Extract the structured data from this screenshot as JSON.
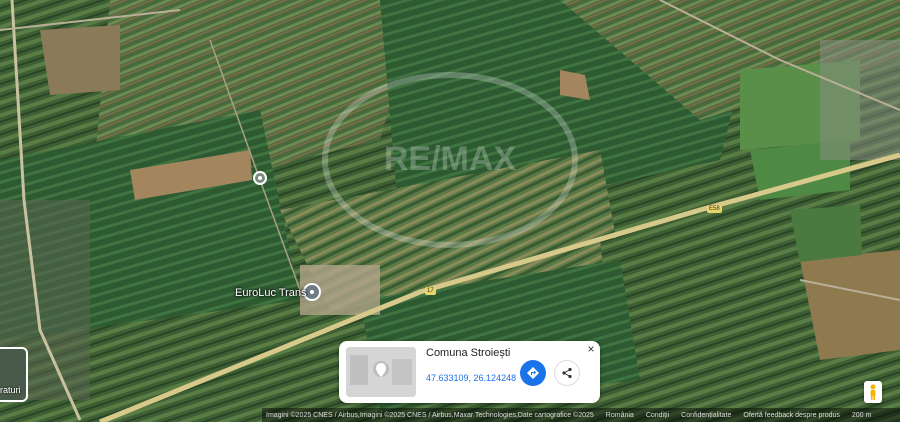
{
  "map": {
    "road_shields": [
      "E58",
      "17"
    ],
    "places": [
      {
        "name": "EuroLuc Trans"
      }
    ],
    "watermark": "RE/MAX"
  },
  "info_card": {
    "title": "Comuna Stroiești",
    "coordinates": "47.633109, 26.124248",
    "directions_icon": "directions-icon",
    "share_icon": "share-icon",
    "close_label": "×"
  },
  "layers_control": {
    "label_fragment": "raturi"
  },
  "pegman": {
    "icon": "pegman-icon"
  },
  "bottom_bar": {
    "imagery_credit": "Imagini ©2025 CNES / Airbus,Imagini ©2025 CNES / Airbus,Maxar Technologies,Date cartografice ©2025",
    "links": [
      "România",
      "Condiții",
      "Confidențialitate",
      "Ofertă feedback despre produs"
    ],
    "scale": "200 m"
  },
  "colors": {
    "accent": "#1a73e8",
    "field_dark": "#2f4a2a",
    "road": "#d7c98a"
  }
}
